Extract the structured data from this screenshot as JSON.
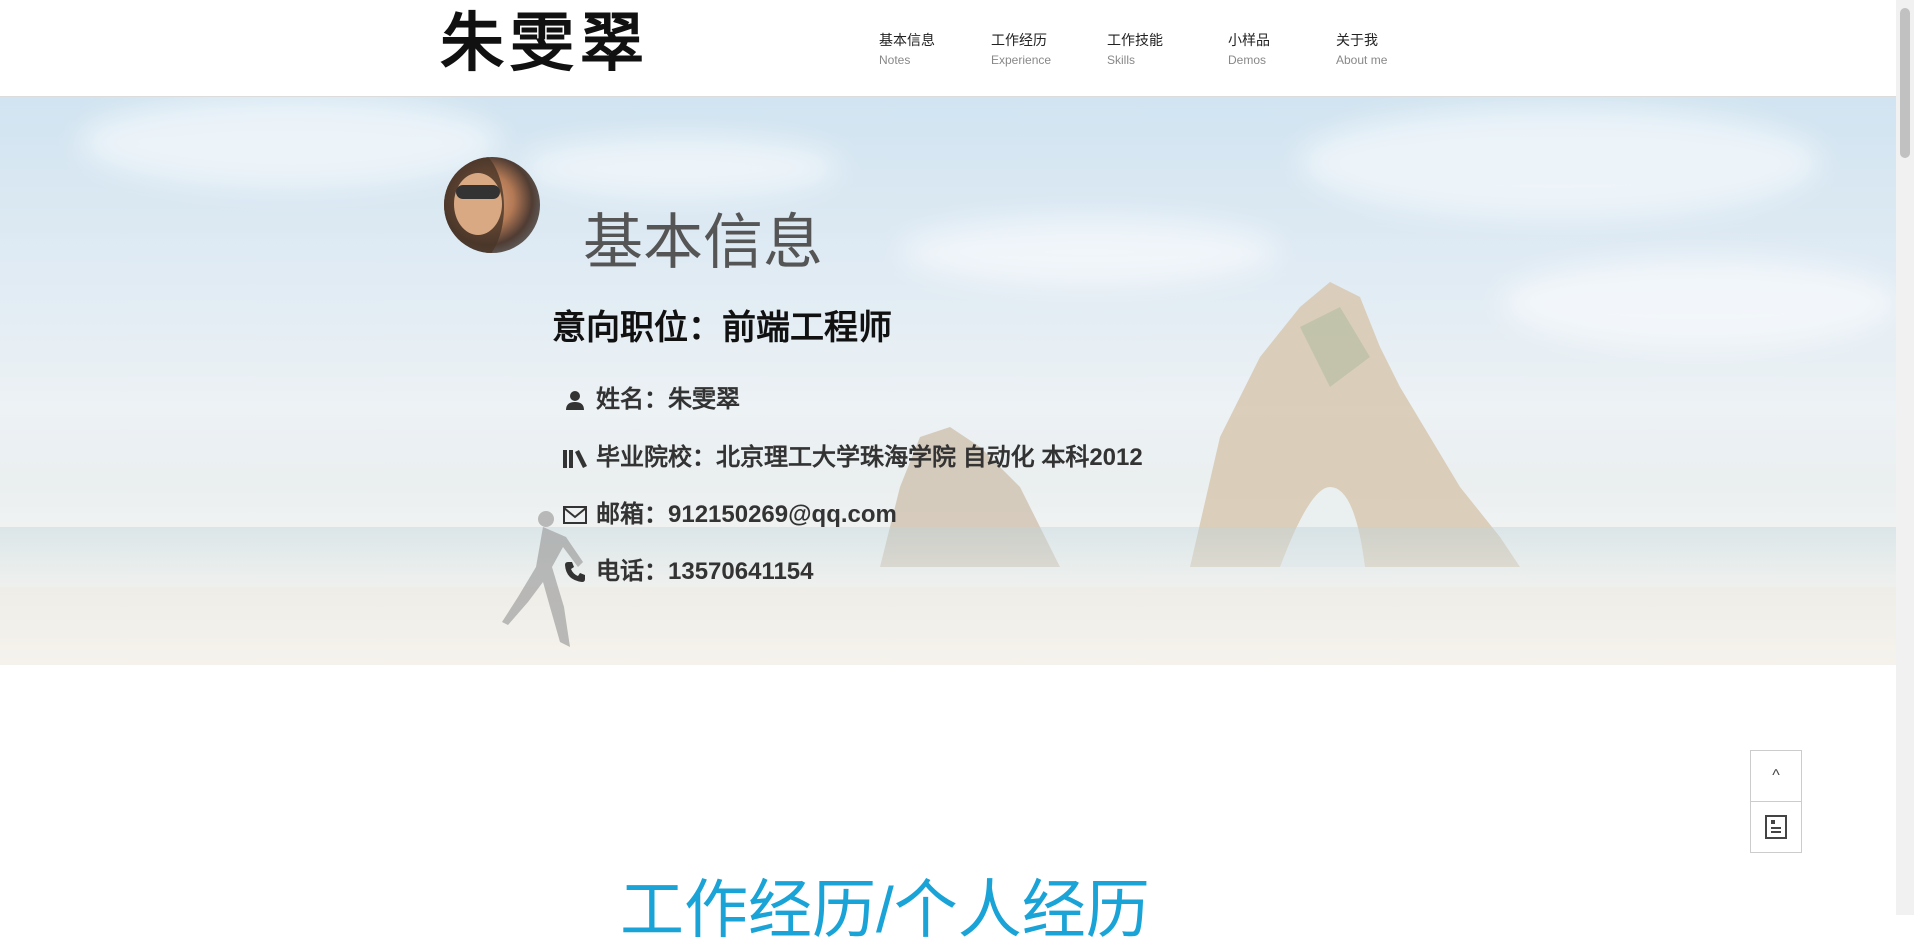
{
  "header": {
    "logo": "朱雯翠",
    "nav": [
      {
        "zh": "基本信息",
        "en": "Notes"
      },
      {
        "zh": "工作经历",
        "en": "Experience"
      },
      {
        "zh": "工作技能",
        "en": "Skills"
      },
      {
        "zh": "小样品",
        "en": "Demos"
      },
      {
        "zh": "关于我",
        "en": "About me"
      }
    ]
  },
  "hero": {
    "section_title": "基本信息",
    "job": "意向职位：前端工程师",
    "info": [
      {
        "icon": "user-icon",
        "text": "姓名：朱雯翠"
      },
      {
        "icon": "books-icon",
        "text": "毕业院校：北京理工大学珠海学院 自动化 本科2012"
      },
      {
        "icon": "mail-icon",
        "text": "邮箱：912150269@qq.com"
      },
      {
        "icon": "phone-icon",
        "text": "电话：13570641154"
      }
    ]
  },
  "widget": {
    "top_label": "^",
    "resume_icon": "document-icon"
  },
  "next_section_title": "工作经历/个人经历",
  "colors": {
    "accent": "#1aa3d6",
    "title_gray": "#555555"
  }
}
